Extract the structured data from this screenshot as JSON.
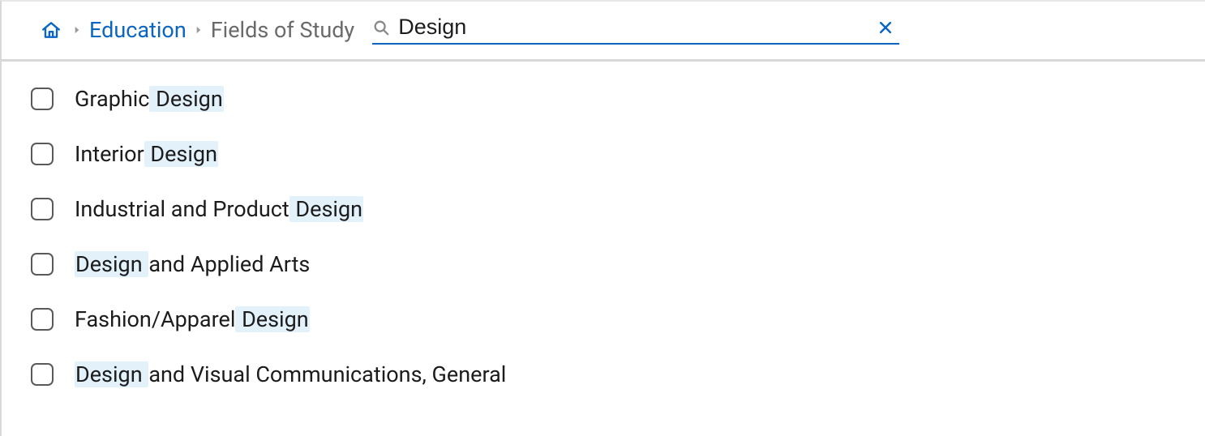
{
  "breadcrumb": {
    "education": "Education",
    "fields_of_study": "Fields of Study"
  },
  "search": {
    "value": "Design",
    "placeholder": ""
  },
  "highlight_term": "Design",
  "results": [
    {
      "label": "Graphic Design"
    },
    {
      "label": "Interior Design"
    },
    {
      "label": "Industrial and Product Design"
    },
    {
      "label": "Design and Applied Arts"
    },
    {
      "label": "Fashion/Apparel Design"
    },
    {
      "label": "Design and Visual Communications, General"
    }
  ]
}
